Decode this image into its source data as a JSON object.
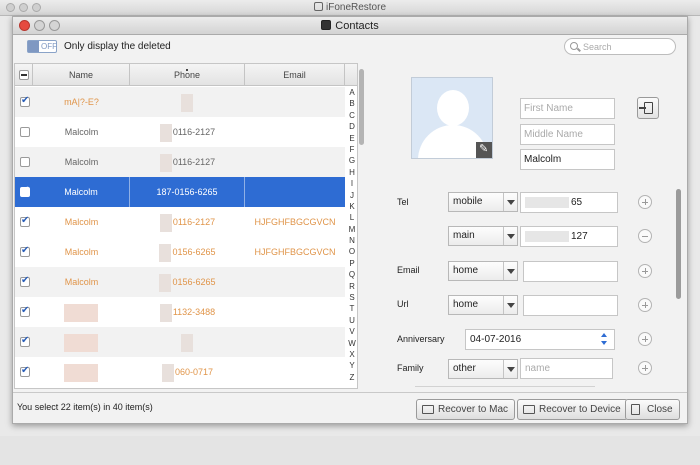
{
  "back_window": {
    "title": "iFoneRestore"
  },
  "dialog": {
    "title": "Contacts"
  },
  "toolbar": {
    "toggle_state": "OFF",
    "toggle_label": "Only display the deleted",
    "search_placeholder": "Search"
  },
  "table": {
    "columns": [
      "Name",
      "Phone",
      "Email"
    ],
    "rows": [
      {
        "name": "mA|?-E?",
        "phone": "",
        "email": "",
        "checked": true,
        "deleted": true,
        "alt": true,
        "selected": false
      },
      {
        "name": "Malcolm",
        "phone": "0116-2127",
        "email": "",
        "checked": false,
        "deleted": false,
        "alt": false,
        "selected": false
      },
      {
        "name": "Malcolm",
        "phone": "0116-2127",
        "email": "",
        "checked": false,
        "deleted": false,
        "alt": true,
        "selected": false
      },
      {
        "name": "Malcolm",
        "phone": "187-0156-6265",
        "email": "",
        "checked": true,
        "deleted": false,
        "alt": false,
        "selected": true
      },
      {
        "name": "Malcolm",
        "phone": "0116-2127",
        "email": "HJFGHFBGCGVCN",
        "checked": true,
        "deleted": true,
        "alt": false,
        "selected": false
      },
      {
        "name": "Malcolm",
        "phone": "0156-6265",
        "email": "HJFGHFBGCGVCN",
        "checked": true,
        "deleted": true,
        "alt": false,
        "selected": false
      },
      {
        "name": "Malcolm",
        "phone": "0156-6265",
        "email": "",
        "checked": true,
        "deleted": true,
        "alt": true,
        "selected": false
      },
      {
        "name": "",
        "phone": "1132-3488",
        "email": "",
        "checked": true,
        "deleted": true,
        "alt": false,
        "selected": false
      },
      {
        "name": "",
        "phone": "",
        "email": "",
        "checked": true,
        "deleted": true,
        "alt": true,
        "selected": false
      },
      {
        "name": "",
        "phone": "060-0717",
        "email": "",
        "checked": true,
        "deleted": true,
        "alt": false,
        "selected": false
      }
    ],
    "alphabet": [
      "A",
      "B",
      "C",
      "D",
      "E",
      "F",
      "G",
      "H",
      "I",
      "J",
      "K",
      "L",
      "M",
      "N",
      "O",
      "P",
      "Q",
      "R",
      "S",
      "T",
      "U",
      "V",
      "W",
      "X",
      "Y",
      "Z"
    ]
  },
  "detail": {
    "first_name_placeholder": "First Name",
    "middle_name_placeholder": "Middle Name",
    "last_name_value": "Malcolm",
    "fields": {
      "tel_label": "Tel",
      "tel1_type": "mobile",
      "tel1_value": "65",
      "tel2_type": "main",
      "tel2_value": "127",
      "email_label": "Email",
      "email_type": "home",
      "url_label": "Url",
      "url_type": "home",
      "anniversary_label": "Anniversary",
      "anniversary_value": "04-07-2016",
      "family_label": "Family",
      "family_type": "other",
      "family_placeholder": "name"
    }
  },
  "footer": {
    "status": "You select 22 item(s) in 40 item(s)",
    "recover_mac": "Recover to Mac",
    "recover_device": "Recover to Device",
    "close": "Close"
  },
  "colors": {
    "selection": "#2e6cd3",
    "deleted_text": "#e0954a",
    "close_light": "#e64a3f"
  }
}
